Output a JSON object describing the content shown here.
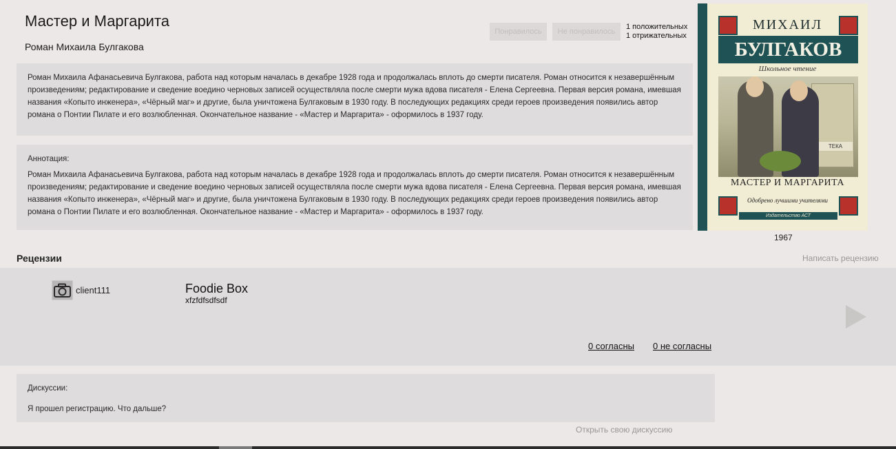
{
  "book": {
    "title": "Мастер и Маргарита",
    "subtitle": "Роман Михаила Булгакова",
    "year": "1967",
    "description": "Роман Михаила Афанасьевича Булгакова, работа над которым началась в декабре 1928 года и продолжалась вплоть до смерти писателя. Роман относится к незавершённым произведениям; редактирование и сведение воедино черновых записей осуществляла после смерти мужа вдова писателя - Елена Сергеевна. Первая версия романа, имевшая названия «Копыто инженера», «Чёрный маг» и другие, была уничтожена Булгаковым в 1930 году. В последующих редакциях среди героев произведения появились автор романа о Понтии Пилате и его возлюбленная. Окончательное название - «Мастер и Маргарита» - оформилось в 1937 году.",
    "annotation_label": "Аннотация:",
    "annotation": "Роман Михаила Афанасьевича Булгакова, работа над которым началась в декабре 1928 года и продолжалась вплоть до смерти писателя. Роман относится к незавершённым произведениям; редактирование и сведение воедино черновых записей осуществляла после смерти мужа вдова писателя - Елена Сергеевна. Первая версия романа, имевшая названия «Копыто инженера», «Чёрный маг» и другие, была уничтожена Булгаковым в 1930 году. В последующих редакциях среди героев произведения появились автор романа о Понтии Пилате и его возлюбленная. Окончательное название - «Мастер и Маргарита» - оформилось в 1937 году."
  },
  "votes": {
    "like_label": "Понравилось",
    "dislike_label": "Не понравилось",
    "positive": "1 положительных",
    "negative": "1 отрижательных"
  },
  "cover": {
    "author_top": "МИХАИЛ",
    "author_band": "БУЛГАКОВ",
    "series": "Школьное чтение",
    "sign": "ТЕКА",
    "title": "МАСТЕР И МАРГАРИТА",
    "approved": "Одобрено лучшими учителями",
    "publisher": "Издательство АСТ"
  },
  "reviews": {
    "heading": "Рецензии",
    "write_link": "Написать рецензию",
    "items": [
      {
        "username": "client111",
        "title": "Foodie Box",
        "text": "xfzfdfsdfsdf",
        "agree": "0 согласны",
        "disagree": "0 не согласны"
      }
    ]
  },
  "discussions": {
    "label": "Дискуссии:",
    "item": "Я прошел регистрацию. Что дальше?",
    "open_link": "Открыть свою дискуссию"
  },
  "icons": {
    "avatar": "camera-icon",
    "next": "play-arrow-icon"
  },
  "colors": {
    "background": "#ece8e7",
    "panel": "#dedcdc",
    "cover_accent": "#1f5254",
    "muted_link": "#9a9696"
  }
}
